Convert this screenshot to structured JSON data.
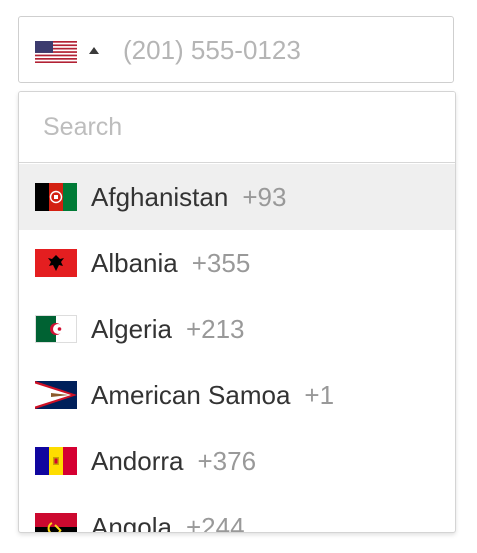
{
  "phone": {
    "placeholder": "(201) 555-0123",
    "selected_country_flag": "us-flag-icon"
  },
  "dropdown": {
    "search_placeholder": "Search",
    "countries": [
      {
        "name": "Afghanistan",
        "code": "+93",
        "flag": "af-flag-icon",
        "highlighted": true
      },
      {
        "name": "Albania",
        "code": "+355",
        "flag": "al-flag-icon"
      },
      {
        "name": "Algeria",
        "code": "+213",
        "flag": "dz-flag-icon"
      },
      {
        "name": "American Samoa",
        "code": "+1",
        "flag": "as-flag-icon"
      },
      {
        "name": "Andorra",
        "code": "+376",
        "flag": "ad-flag-icon"
      },
      {
        "name": "Angola",
        "code": "+244",
        "flag": "ao-flag-icon"
      }
    ]
  },
  "colors": {
    "highlight_bg": "#efefef",
    "text": "#333333",
    "dial_code": "#999999",
    "placeholder": "#b5b5b5",
    "border": "#cfcfcf"
  }
}
